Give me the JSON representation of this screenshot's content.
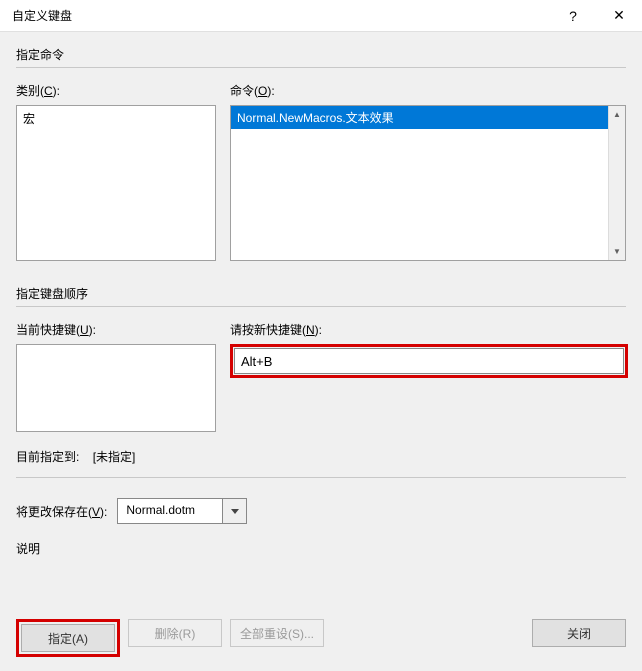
{
  "titlebar": {
    "title": "自定义键盘",
    "help": "?",
    "close": "✕"
  },
  "section_specify_cmd": "指定命令",
  "categories": {
    "label_pre": "类别(",
    "label_hot": "C",
    "label_post": "):",
    "item": "宏"
  },
  "commands": {
    "label_pre": "命令(",
    "label_hot": "O",
    "label_post": "):",
    "selected": "Normal.NewMacros.文本效果"
  },
  "section_sequence": "指定键盘顺序",
  "current_keys": {
    "label_pre": "当前快捷键(",
    "label_hot": "U",
    "label_post": "):"
  },
  "new_key": {
    "label_pre": "请按新快捷键(",
    "label_hot": "N",
    "label_post": "):",
    "value": "Alt+B"
  },
  "assigned": {
    "label": "目前指定到:",
    "value": "[未指定]"
  },
  "save_in": {
    "label_pre": "将更改保存在(",
    "label_hot": "V",
    "label_post": "):",
    "value": "Normal.dotm"
  },
  "description_label": "说明",
  "buttons": {
    "assign": "指定(A)",
    "remove": "删除(R)",
    "reset": "全部重设(S)...",
    "close": "关闭"
  }
}
